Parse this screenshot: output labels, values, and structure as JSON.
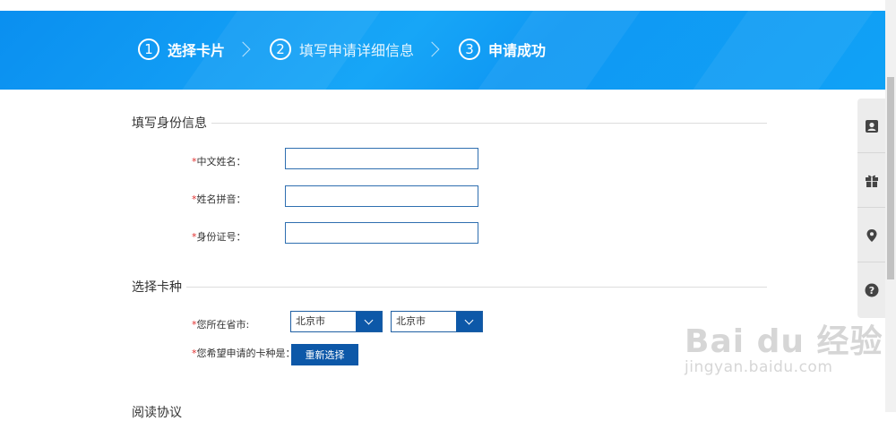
{
  "steps": [
    {
      "num": "1",
      "label": "选择卡片"
    },
    {
      "num": "2",
      "label": "填写申请详细信息"
    },
    {
      "num": "3",
      "label": "申请成功"
    }
  ],
  "identity": {
    "title": "填写身份信息",
    "fields": [
      {
        "required": "*",
        "label": "中文姓名：",
        "value": ""
      },
      {
        "required": "*",
        "label": "姓名拼音：",
        "value": ""
      },
      {
        "required": "*",
        "label": "身份证号：",
        "value": ""
      }
    ]
  },
  "card_type": {
    "title": "选择卡种",
    "location_label": "您所在省市:",
    "province": "北京市",
    "city": "北京市",
    "card_label": "您希望申请的卡种是：",
    "reselect_button": "重新选择"
  },
  "next_section": {
    "title": "阅读协议"
  },
  "sidebar": [
    "contact-card-icon",
    "gift-icon",
    "location-pin-icon",
    "help-icon"
  ],
  "watermark": {
    "brand": "Bai du 经验",
    "url": "jingyan.baidu.com"
  },
  "colors": {
    "banner": "#0a8ff0",
    "accent": "#0d58a8",
    "required": "#e0302f"
  }
}
